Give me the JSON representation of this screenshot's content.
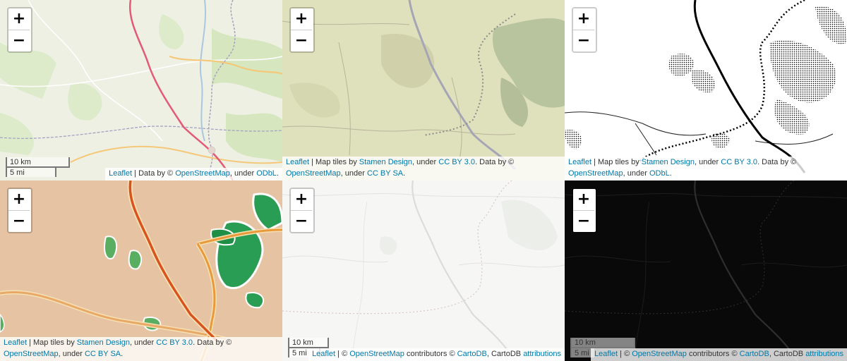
{
  "zoom": {
    "in_label": "+",
    "out_label": "−"
  },
  "scale": {
    "km": "10 km",
    "mi": "5 mi"
  },
  "colors": {
    "link": "#0078A8",
    "osm_bg": "#eef0e4",
    "terrain_bg": "#dfe0bc",
    "toner_bg": "#ffffff",
    "watercolor_bg": "#e8c7a8",
    "positron_bg": "#f6f6f4",
    "darkmatter_bg": "#090909"
  },
  "panels": {
    "osm": {
      "attr": {
        "leaflet": "Leaflet",
        "t1": " | Data by © ",
        "osm": "OpenStreetMap",
        "t2": ", under ",
        "lic": "ODbL",
        "t3": "."
      }
    },
    "terrain": {
      "attr": {
        "leaflet": "Leaflet",
        "t1": " | Map tiles by ",
        "stamen": "Stamen Design",
        "t2": ", under ",
        "cc": "CC BY 3.0",
        "t3": ". Data by © ",
        "osm": "OpenStreetMap",
        "t4": ", under ",
        "ccsa": "CC BY SA",
        "t5": "."
      }
    },
    "toner": {
      "attr": {
        "leaflet": "Leaflet",
        "t1": " | Map tiles by ",
        "stamen": "Stamen Design",
        "t2": ", under ",
        "cc": "CC BY 3.0",
        "t3": ". Data by © ",
        "osm": "OpenStreetMap",
        "t4": ", under ",
        "lic": "ODbL",
        "t5": "."
      }
    },
    "watercolor": {
      "attr": {
        "leaflet": "Leaflet",
        "t1": " | Map tiles by ",
        "stamen": "Stamen Design",
        "t2": ", under ",
        "cc": "CC BY 3.0",
        "t3": ". Data by © ",
        "osm": "OpenStreetMap",
        "t4": ", under ",
        "ccsa": "CC BY SA",
        "t5": "."
      }
    },
    "positron": {
      "attr": {
        "leaflet": "Leaflet",
        "t1": " | © ",
        "osm": "OpenStreetMap",
        "t2": " contributors © ",
        "carto": "CartoDB",
        "t3": ", CartoDB ",
        "attrib": "attributions"
      }
    },
    "darkmatter": {
      "attr": {
        "leaflet": "Leaflet",
        "t1": " | © ",
        "osm": "OpenStreetMap",
        "t2": " contributors © ",
        "carto": "CartoDB",
        "t3": ", CartoDB ",
        "attrib": "attributions"
      }
    }
  }
}
